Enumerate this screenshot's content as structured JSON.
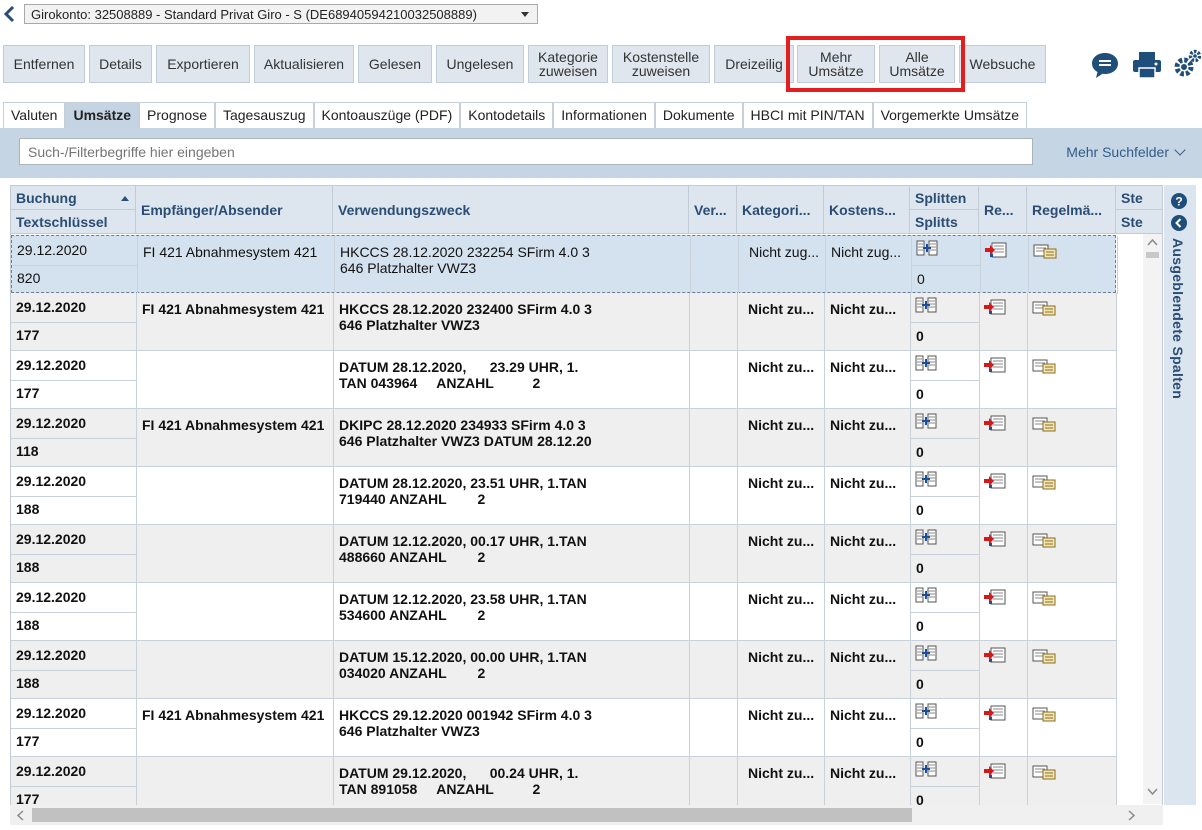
{
  "account": {
    "select_value": "Girokonto: 32508889 - Standard Privat Giro - S (DE68940594210032508889)"
  },
  "toolbar": {
    "buttons": [
      {
        "label": "Entfernen"
      },
      {
        "label": "Details"
      },
      {
        "label": "Exportieren"
      },
      {
        "label": "Aktualisieren"
      },
      {
        "label": "Gelesen"
      },
      {
        "label": "Ungelesen"
      },
      {
        "label": "Kategorie\nzuweisen"
      },
      {
        "label": "Kostenstelle\nzuweisen"
      },
      {
        "label": "Dreizeilig"
      },
      {
        "label": "Mehr\nUmsätze"
      },
      {
        "label": "Alle\nUmsätze"
      },
      {
        "label": "Websuche"
      }
    ],
    "highlight_color": "#e11f1f"
  },
  "tabs": [
    {
      "label": "Valuten"
    },
    {
      "label": "Umsätze"
    },
    {
      "label": "Prognose"
    },
    {
      "label": "Tagesauszug"
    },
    {
      "label": "Kontoauszüge (PDF)"
    },
    {
      "label": "Kontodetails"
    },
    {
      "label": "Informationen"
    },
    {
      "label": "Dokumente"
    },
    {
      "label": "HBCI mit PIN/TAN"
    },
    {
      "label": "Vorgemerkte Umsätze"
    }
  ],
  "search": {
    "placeholder": "Such-/Filterbegriffe hier eingeben",
    "more_fields": "Mehr Suchfelder"
  },
  "grid": {
    "headers": {
      "buchung": "Buchung",
      "textschluessel": "Textschlüssel",
      "empfaenger": "Empfänger/Absender",
      "verwendung": "Verwendungszweck",
      "ver": "Ver...",
      "kategorie": "Kategori...",
      "kostenstelle": "Kostens...",
      "splitten": "Splitten",
      "splitts": "Splitts",
      "re": "Re...",
      "regelm": "Regelmä...",
      "ste1": "Ste",
      "ste2": "Ste"
    },
    "rows": [
      {
        "date": "29.12.2020",
        "code": "820",
        "empf": "FI 421 Abnahmesystem 421",
        "v1": "HKCCS 28.12.2020 232254 SFirm 4.0 3",
        "v2": "646 Platzhalter VWZ3",
        "kat": "Nicht zug...",
        "kost": "Nicht zug...",
        "splitts": "0"
      },
      {
        "date": "29.12.2020",
        "code": "177",
        "empf": "FI 421 Abnahmesystem 421",
        "v1": "HKCCS 28.12.2020 232400 SFirm 4.0 3",
        "v2": "646 Platzhalter VWZ3",
        "kat": "Nicht zu...",
        "kost": "Nicht zu...",
        "splitts": "0"
      },
      {
        "date": "29.12.2020",
        "code": "177",
        "empf": "",
        "v1": "DATUM 28.12.2020,      23.29 UHR, 1.",
        "v2": "TAN 043964     ANZAHL          2",
        "kat": "Nicht zu...",
        "kost": "Nicht zu...",
        "splitts": "0"
      },
      {
        "date": "29.12.2020",
        "code": "118",
        "empf": "FI 421 Abnahmesystem 421",
        "v1": "DKIPC 28.12.2020 234933 SFirm 4.0 3",
        "v2": "646 Platzhalter VWZ3 DATUM 28.12.20",
        "kat": "Nicht zu...",
        "kost": "Nicht zu...",
        "splitts": "0"
      },
      {
        "date": "29.12.2020",
        "code": "188",
        "empf": "",
        "v1": "DATUM 28.12.2020, 23.51 UHR, 1.TAN",
        "v2": "719440 ANZAHL        2",
        "kat": "Nicht zu...",
        "kost": "Nicht zu...",
        "splitts": "0"
      },
      {
        "date": "29.12.2020",
        "code": "188",
        "empf": "",
        "v1": "DATUM 12.12.2020, 00.17 UHR, 1.TAN",
        "v2": "488660 ANZAHL        2",
        "kat": "Nicht zu...",
        "kost": "Nicht zu...",
        "splitts": "0"
      },
      {
        "date": "29.12.2020",
        "code": "188",
        "empf": "",
        "v1": "DATUM 12.12.2020, 23.58 UHR, 1.TAN",
        "v2": "534600 ANZAHL        2",
        "kat": "Nicht zu...",
        "kost": "Nicht zu...",
        "splitts": "0"
      },
      {
        "date": "29.12.2020",
        "code": "188",
        "empf": "",
        "v1": "DATUM 15.12.2020, 00.00 UHR, 1.TAN",
        "v2": "034020 ANZAHL        2",
        "kat": "Nicht zu...",
        "kost": "Nicht zu...",
        "splitts": "0"
      },
      {
        "date": "29.12.2020",
        "code": "177",
        "empf": "FI 421 Abnahmesystem 421",
        "v1": "HKCCS 29.12.2020 001942 SFirm 4.0 3",
        "v2": "646 Platzhalter VWZ3",
        "kat": "Nicht zu...",
        "kost": "Nicht zu...",
        "splitts": "0"
      },
      {
        "date": "29.12.2020",
        "code": "177",
        "empf": "",
        "v1": "DATUM 29.12.2020,      00.24 UHR, 1.",
        "v2": "TAN 891058     ANZAHL          2",
        "kat": "Nicht zu...",
        "kost": "Nicht zu...",
        "splitts": "0"
      }
    ]
  },
  "side_panel": {
    "label": "Ausgeblendete Spalten"
  },
  "icons": {
    "back": "chevron-left-icon",
    "chat": "chat-bubble-icon",
    "print": "printer-icon",
    "settings": "gears-icon",
    "help": "help-icon",
    "collapse": "chevron-left-circle-icon",
    "split": "split-icon",
    "receipt": "receipt-icon",
    "recurring": "recurring-icon"
  },
  "colors": {
    "accent": "#2a4d73",
    "header_bg": "#dde6ef",
    "band": "#c6d5e4",
    "selected_row": "#d4e1ee"
  }
}
